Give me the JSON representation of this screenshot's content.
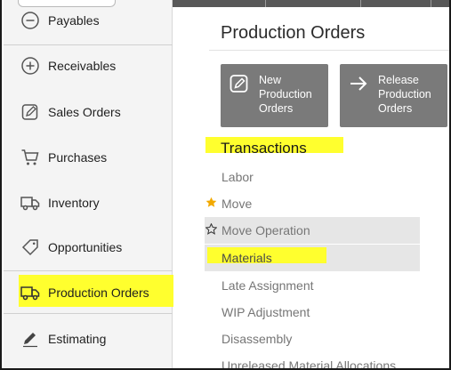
{
  "sidebar": {
    "items": [
      {
        "label": "Payables",
        "icon": "minus-circle-icon"
      },
      {
        "label": "Receivables",
        "icon": "plus-circle-icon"
      },
      {
        "label": "Sales Orders",
        "icon": "pencil-square-icon"
      },
      {
        "label": "Purchases",
        "icon": "cart-icon"
      },
      {
        "label": "Inventory",
        "icon": "truck-icon"
      },
      {
        "label": "Opportunities",
        "icon": "tag-icon"
      },
      {
        "label": "Production Orders",
        "icon": "truck-icon"
      },
      {
        "label": "Estimating",
        "icon": "pencil-icon"
      }
    ],
    "active_item": "Production Orders"
  },
  "main": {
    "title": "Production Orders",
    "tiles": [
      {
        "label": "New\nProduction\nOrders",
        "icon": "edit-icon"
      },
      {
        "label": "Release\nProduction\nOrders",
        "icon": "arrow-right-icon"
      }
    ],
    "section_title": "Transactions",
    "transactions": [
      {
        "label": "Labor",
        "star": "none"
      },
      {
        "label": "Move",
        "star": "filled"
      },
      {
        "label": "Move Operation",
        "star": "outline"
      },
      {
        "label": "Materials",
        "star": "none"
      },
      {
        "label": "Late Assignment",
        "star": "none"
      },
      {
        "label": "WIP Adjustment",
        "star": "none"
      },
      {
        "label": "Disassembly",
        "star": "none"
      },
      {
        "label": "Unreleased Material Allocations",
        "star": "none"
      }
    ]
  },
  "colors": {
    "highlight": "#ffff2e",
    "tile_bg": "#7a7a7a",
    "star_filled": "#f2a900",
    "topbar": "#585858"
  }
}
